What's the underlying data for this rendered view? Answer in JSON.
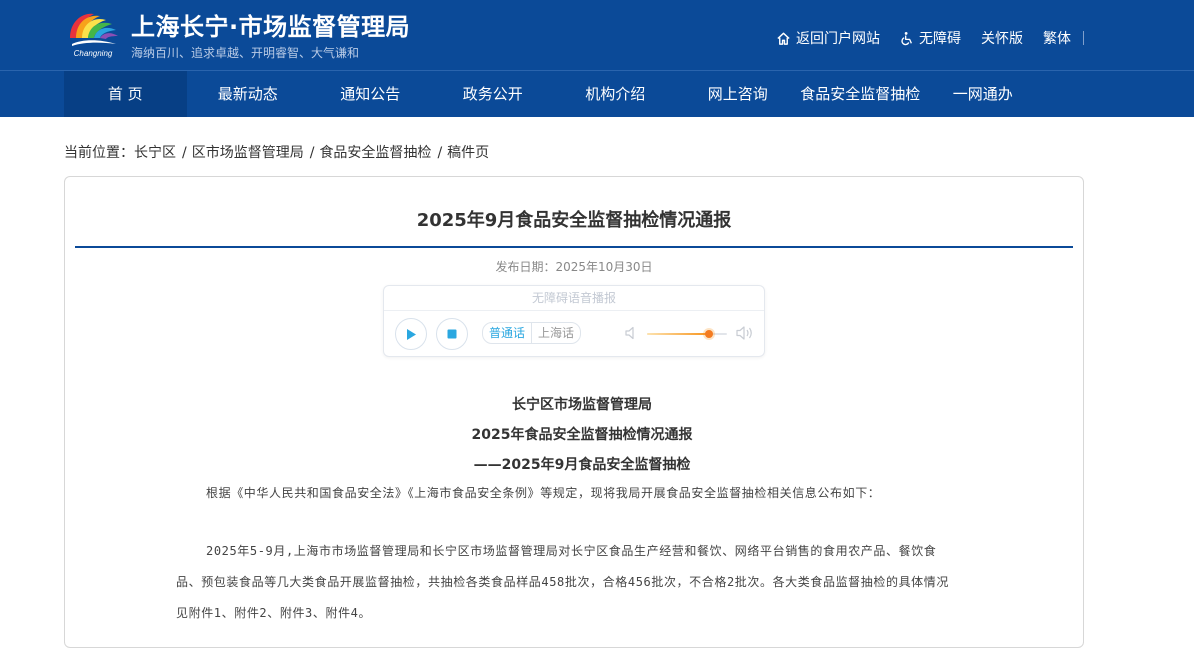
{
  "header": {
    "title": "上海长宁·市场监督管理局",
    "slogan": "海纳百川、追求卓越、开明睿智、大气谦和",
    "links": {
      "portal": "返回门户网站",
      "accessible": "无障碍",
      "care": "关怀版",
      "traditional": "繁体"
    }
  },
  "nav": {
    "items": [
      "首 页",
      "最新动态",
      "通知公告",
      "政务公开",
      "机构介绍",
      "网上咨询",
      "食品安全监督抽检",
      "一网通办"
    ],
    "active_index": 0
  },
  "breadcrumb": {
    "prefix": "当前位置：",
    "items": [
      "长宁区",
      "区市场监督管理局",
      "食品安全监督抽检",
      "稿件页"
    ],
    "separator": "/"
  },
  "article": {
    "title": "2025年9月食品安全监督抽检情况通报",
    "publish_date": "发布日期：2025年10月30日",
    "heading_lines": [
      "长宁区市场监督管理局",
      "2025年食品安全监督抽检情况通报",
      "——2025年9月食品安全监督抽检"
    ],
    "paragraphs": [
      "根据《中华人民共和国食品安全法》《上海市食品安全条例》等规定，现将我局开展食品安全监督抽检相关信息公布如下：",
      "2025年5-9月,上海市市场监督管理局和长宁区市场监督管理局对长宁区食品生产经营和餐饮、网络平台销售的食用农产品、餐饮食品、预包装食品等几大类食品开展监督抽检，共抽检各类食品样品458批次，合格456批次，不合格2批次。各大类食品监督抽检的具体情况见附件1、附件2、附件3、附件4。"
    ]
  },
  "player": {
    "header": "无障碍语音播报",
    "lang_mandarin": "普通话",
    "lang_shanghai": "上海话",
    "volume": 0.78
  },
  "colors": {
    "brand_blue": "#0b4a98",
    "nav_active": "#073f85",
    "accent_cyan": "#2aa7e0",
    "volume_orange": "#f47b20"
  },
  "icons": [
    "home-icon",
    "wheelchair-icon",
    "play-icon",
    "stop-icon",
    "volume-low-icon",
    "volume-high-icon"
  ]
}
